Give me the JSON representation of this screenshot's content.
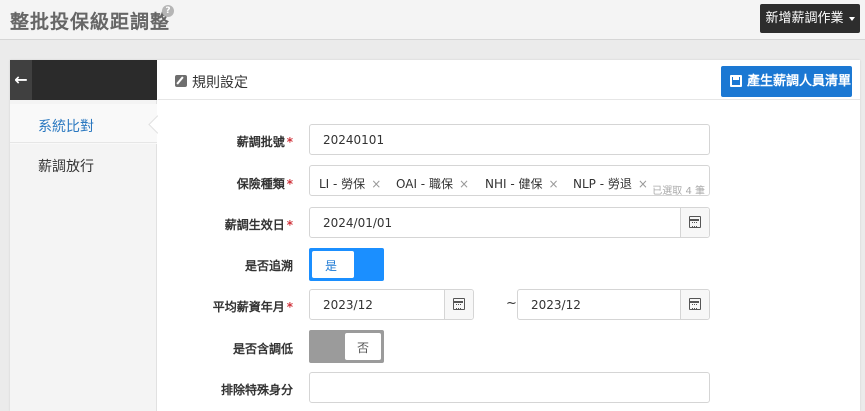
{
  "header": {
    "title": "整批投保級距調整",
    "help_icon": "?",
    "new_job_label": "新增薪調作業"
  },
  "sidebar": {
    "back_icon": "←",
    "items": [
      {
        "label": "系統比對",
        "active": true
      },
      {
        "label": "薪調放行",
        "active": false
      }
    ]
  },
  "main": {
    "section_title": "規則設定",
    "generate_button_label": "產生薪調人員清單"
  },
  "form": {
    "batch_no": {
      "label": "薪調批號",
      "value": "20240101"
    },
    "insurance_types": {
      "label": "保險種類",
      "tags": [
        "LI - 勞保",
        "OAI - 職保",
        "NHI - 健保",
        "NLP - 勞退"
      ],
      "selected_count_text": "已選取 4 筆",
      "remove_symbol": "×"
    },
    "effective_date": {
      "label": "薪調生效日",
      "value": "2024/01/01"
    },
    "retroactive": {
      "label": "是否追溯",
      "toggle_text": "是",
      "state": "on"
    },
    "avg_salary_month": {
      "label": "平均薪資年月",
      "from": "2023/12",
      "to": "2023/12",
      "separator": "~"
    },
    "include_decrease": {
      "label": "是否含調低",
      "toggle_text": "否",
      "state": "off"
    },
    "exclude_identity": {
      "label": "排除特殊身分",
      "value": ""
    }
  },
  "required_mark": "*",
  "colors": {
    "accent": "#1b78d3",
    "toggle_on": "#1b8fff",
    "toggle_off": "#9b9b9b",
    "dark_button": "#2d2d2d",
    "required": "#d0333b"
  }
}
